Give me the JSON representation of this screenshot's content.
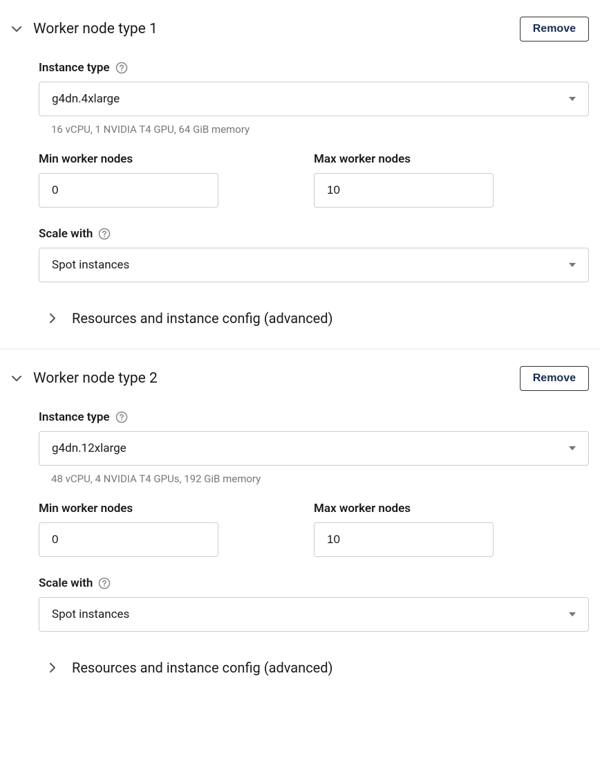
{
  "workers": [
    {
      "title": "Worker node type 1",
      "remove_label": "Remove",
      "instance_type_label": "Instance type",
      "instance_type_value": "g4dn.4xlarge",
      "instance_type_hint": "16 vCPU, 1 NVIDIA T4 GPU, 64 GiB memory",
      "min_label": "Min worker nodes",
      "min_value": "0",
      "max_label": "Max worker nodes",
      "max_value": "10",
      "scale_label": "Scale with",
      "scale_value": "Spot instances",
      "advanced_label": "Resources and instance config (advanced)"
    },
    {
      "title": "Worker node type 2",
      "remove_label": "Remove",
      "instance_type_label": "Instance type",
      "instance_type_value": "g4dn.12xlarge",
      "instance_type_hint": "48 vCPU, 4 NVIDIA T4 GPUs, 192 GiB memory",
      "min_label": "Min worker nodes",
      "min_value": "0",
      "max_label": "Max worker nodes",
      "max_value": "10",
      "scale_label": "Scale with",
      "scale_value": "Spot instances",
      "advanced_label": "Resources and instance config (advanced)"
    }
  ]
}
